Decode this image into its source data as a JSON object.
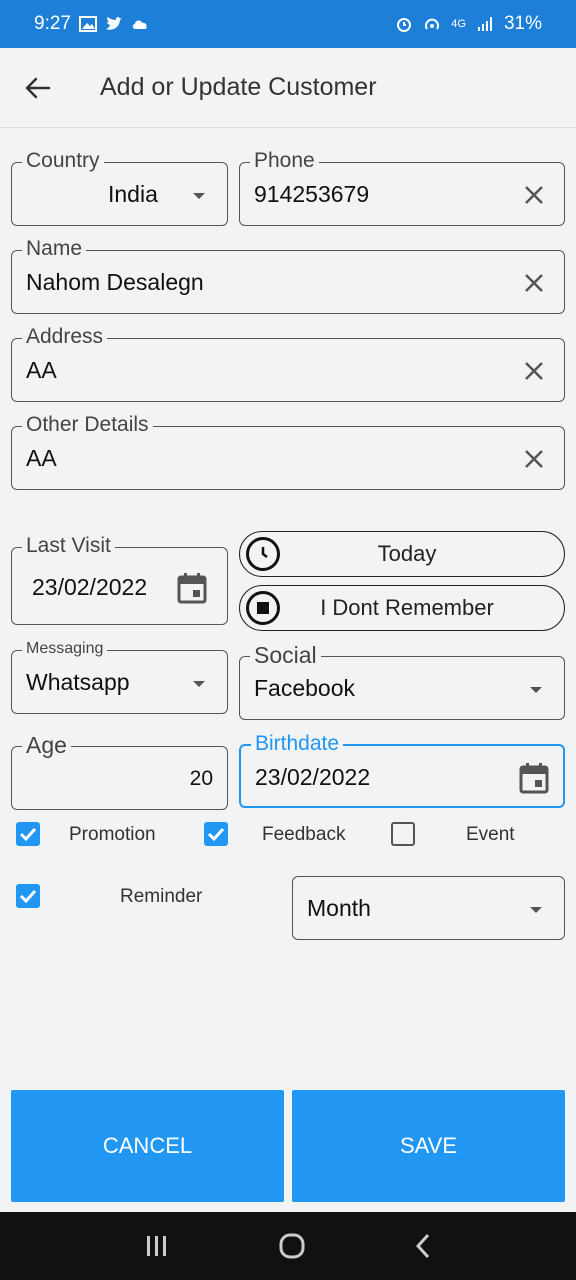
{
  "status": {
    "time": "9:27",
    "battery": "31%",
    "network": "4G"
  },
  "appbar": {
    "title": "Add or Update Customer"
  },
  "form": {
    "country": {
      "label": "Country",
      "value": "India"
    },
    "phone": {
      "label": "Phone",
      "value": "914253679"
    },
    "name": {
      "label": "Name",
      "value": "Nahom Desalegn"
    },
    "address": {
      "label": "Address",
      "value": "AA"
    },
    "other": {
      "label": "Other Details",
      "value": "AA"
    },
    "last_visit": {
      "label": "Last Visit",
      "value": "23/02/2022"
    },
    "today_label": "Today",
    "dont_remember_label": "I Dont Remember",
    "messaging": {
      "label": "Messaging",
      "value": "Whatsapp"
    },
    "social": {
      "label": "Social",
      "value": "Facebook"
    },
    "age": {
      "label": "Age",
      "value": "20"
    },
    "birthdate": {
      "label": "Birthdate",
      "value": "23/02/2022"
    },
    "checks": {
      "promotion": {
        "label": "Promotion",
        "checked": true
      },
      "feedback": {
        "label": "Feedback",
        "checked": true
      },
      "event": {
        "label": "Event",
        "checked": false
      },
      "reminder": {
        "label": "Reminder",
        "checked": true
      }
    },
    "reminder_period": "Month"
  },
  "actions": {
    "cancel": "CANCEL",
    "save": "SAVE"
  },
  "colors": {
    "status_bar": "#1e7fd9",
    "accent": "#2196f3",
    "nav_bar": "#111111"
  }
}
